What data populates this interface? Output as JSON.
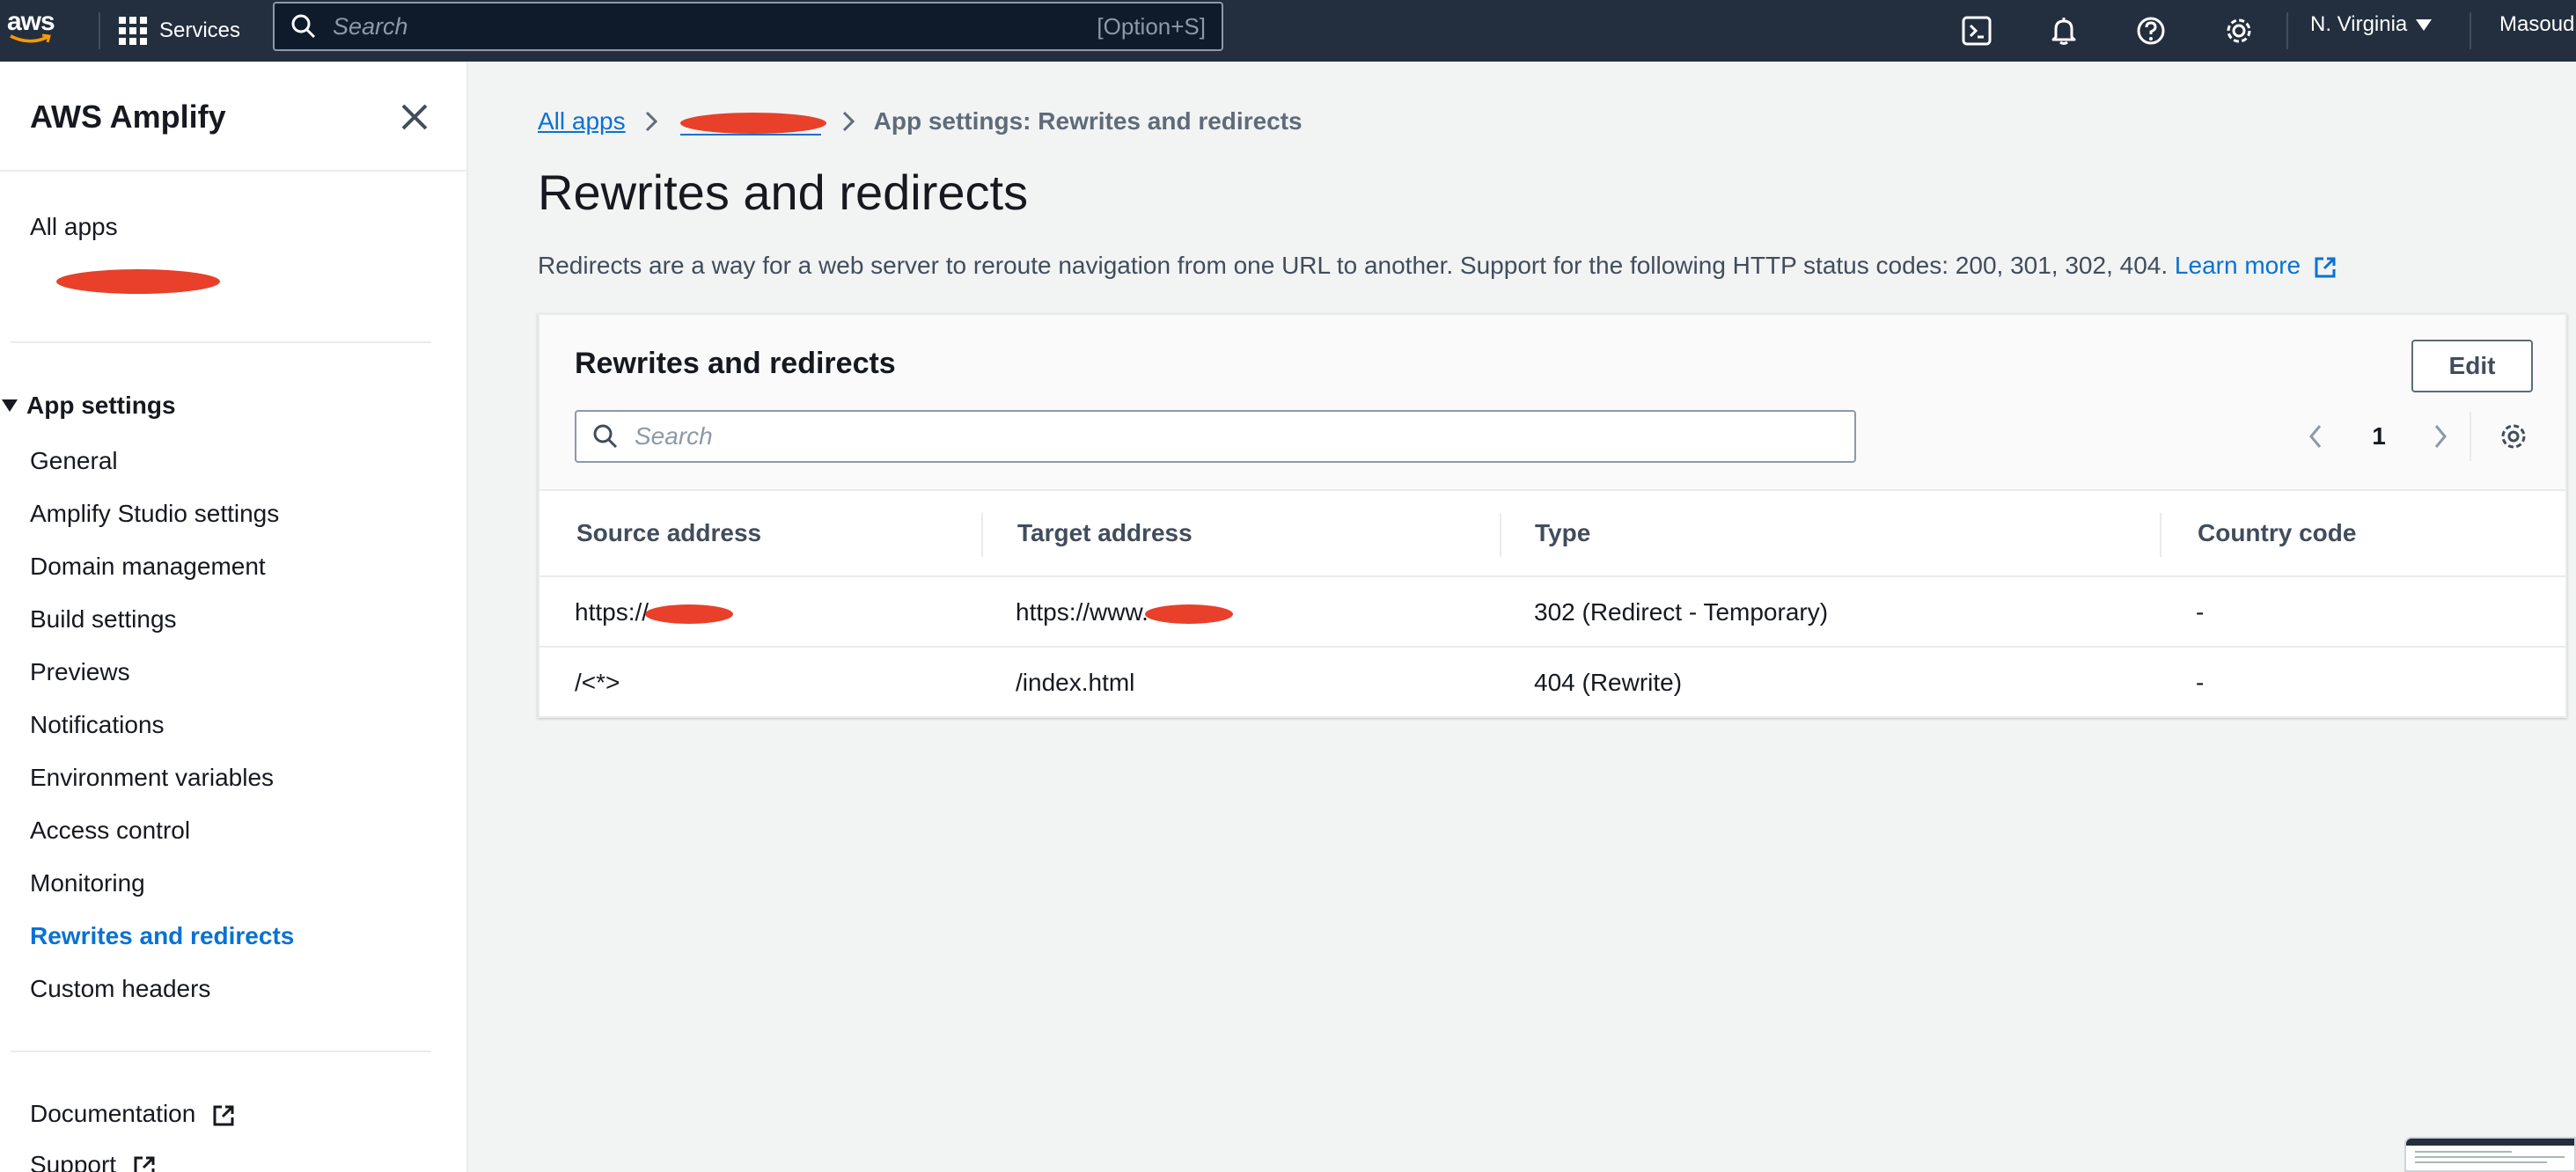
{
  "topnav": {
    "logo_text": "aws",
    "services_label": "Services",
    "search_placeholder": "Search",
    "search_shortcut": "[Option+S]",
    "region_label": "N. Virginia",
    "user_label": "Masoud",
    "icons": [
      "cloudshell-icon",
      "notifications-bell-icon",
      "help-icon",
      "settings-gear-icon"
    ]
  },
  "sidebar": {
    "title": "AWS Amplify",
    "all_apps": "All apps",
    "section_heading": "App settings",
    "items": [
      {
        "label": "General"
      },
      {
        "label": "Amplify Studio settings"
      },
      {
        "label": "Domain management"
      },
      {
        "label": "Build settings"
      },
      {
        "label": "Previews"
      },
      {
        "label": "Notifications"
      },
      {
        "label": "Environment variables"
      },
      {
        "label": "Access control"
      },
      {
        "label": "Monitoring"
      },
      {
        "label": "Rewrites and redirects",
        "active": true
      },
      {
        "label": "Custom headers"
      }
    ],
    "footer_links": [
      {
        "label": "Documentation"
      },
      {
        "label": "Support"
      }
    ]
  },
  "breadcrumb": {
    "root": "All apps",
    "current": "App settings: Rewrites and redirects"
  },
  "page": {
    "title": "Rewrites and redirects",
    "description": "Redirects are a way for a web server to reroute navigation from one URL to another. Support for the following HTTP status codes: 200, 301, 302, 404.",
    "learn_more": "Learn more"
  },
  "panel": {
    "title": "Rewrites and redirects",
    "edit_label": "Edit",
    "search_placeholder": "Search",
    "current_page": "1",
    "columns": [
      "Source address",
      "Target address",
      "Type",
      "Country code"
    ],
    "rows": [
      {
        "source": "https://",
        "target": "https://www.",
        "type": "302 (Redirect - Temporary)",
        "country": "-"
      },
      {
        "source": "/<*>",
        "target": "/index.html",
        "type": "404 (Rewrite)",
        "country": "-"
      }
    ]
  },
  "colors": {
    "nav_bg": "#232f3e",
    "link_blue": "#0972d3",
    "redaction_red": "#e8402a"
  }
}
